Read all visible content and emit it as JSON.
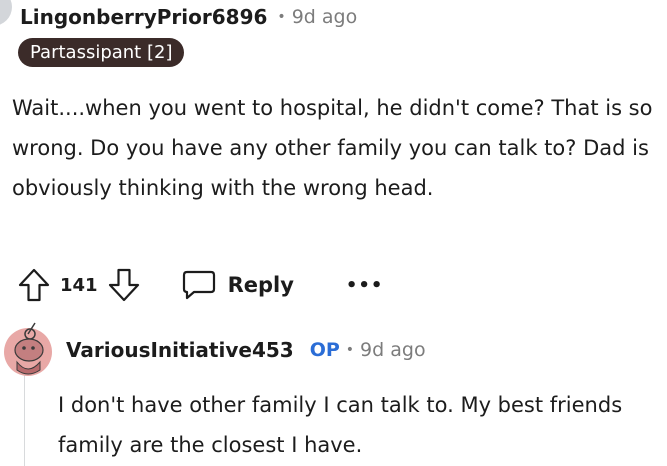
{
  "comment1": {
    "username": "LingonberryPrior6896",
    "separator": "•",
    "time": "9d ago",
    "flair": "Partassipant [2]",
    "body": "Wait....when you went to hospital, he didn't come? That is so wrong. Do you have any other family you can talk to? Dad is obviously thinking with the wrong head.",
    "votes": "141",
    "reply_label": "Reply",
    "more_label": "•••",
    "icons": {
      "upvote": "upvote-arrow-icon",
      "downvote": "downvote-arrow-icon",
      "reply": "speech-bubble-icon",
      "more": "ellipsis-icon"
    }
  },
  "comment2": {
    "username": "VariousInitiative453",
    "op_badge": "OP",
    "separator": "•",
    "time": "9d ago",
    "body": "I don't have other family I can talk to. My best friends family are the closest I have.",
    "avatar_icon": "snoo-avatar-icon"
  },
  "colors": {
    "flair_bg": "#3b2b29",
    "op_blue": "#2b6dd6",
    "avatar_pink": "#e8a8a6",
    "muted": "#7c7c7c"
  }
}
